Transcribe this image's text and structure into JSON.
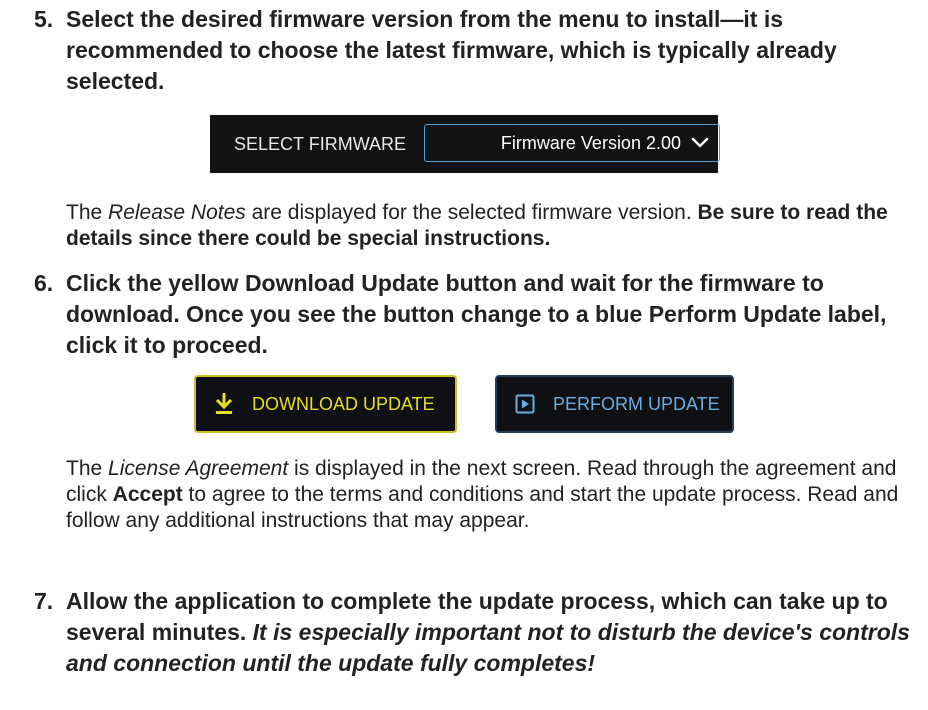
{
  "step5": {
    "number": "5.",
    "text": "Select the desired firmware version from the menu to install—it is recommended to choose the latest firmware, which is typically already selected."
  },
  "firmware_selector": {
    "label": "SELECT FIRMWARE",
    "selected_value": "Firmware Version 2.00"
  },
  "release_notes": {
    "prefix": "The ",
    "italic": "Release Notes",
    "middle": " are displayed for the selected firmware version. ",
    "bold": "Be sure to read the details since there could be special instructions."
  },
  "step6": {
    "number": "6.",
    "text": "Click the yellow Download Update button and wait for the firmware to download. Once you see the button change to a blue Perform Update label, click it to proceed."
  },
  "buttons": {
    "download_label": "DOWNLOAD UPDATE",
    "perform_label": "PERFORM UPDATE",
    "download_color": "#e6de24",
    "perform_color": "#6aaee0"
  },
  "license": {
    "prefix": "The ",
    "italic": "License Agreement",
    "middle": " is displayed in the next screen. Read through the agreement and click ",
    "bold": "Accept",
    "suffix": " to agree to the terms and conditions and start the update process. Read and follow any additional instructions that may appear."
  },
  "step7": {
    "number": "7.",
    "text": "Allow the application to complete the update process, which can take up to several minutes. ",
    "italic": "It is especially important not to disturb the device's controls and connection until the update fully completes!"
  }
}
